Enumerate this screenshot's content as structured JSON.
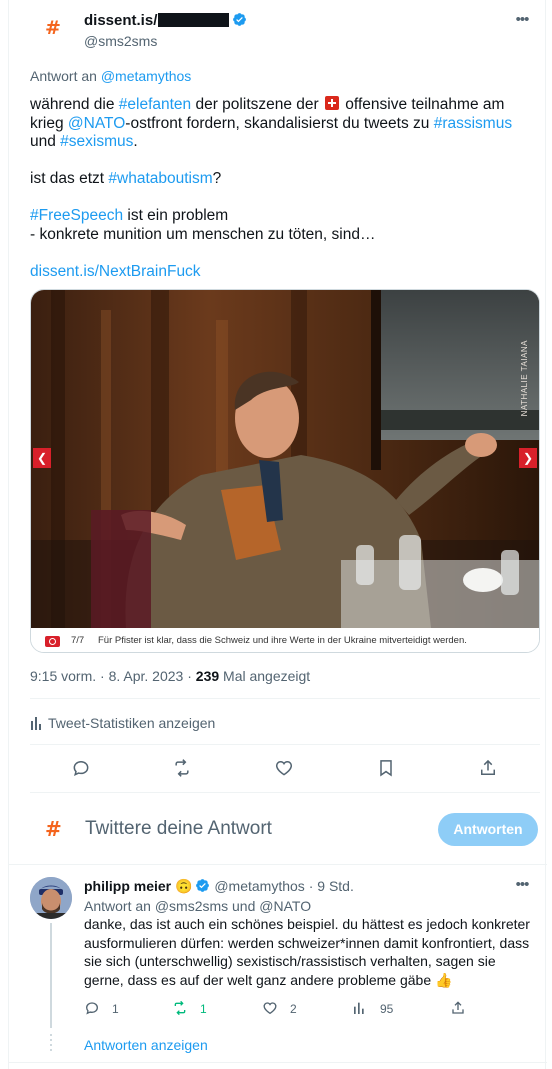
{
  "tweet": {
    "author_name": "dissent.is/",
    "author_handle": "@sms2sms",
    "reply_to_label": "Antwort an",
    "reply_to_handle": "@metamythos",
    "body": {
      "l1_a": "während die ",
      "l1_tag_elefanten": "#elefanten",
      "l1_b": " der politszene der ",
      "l1_c": " offensive teilnahme am",
      "l2_a": "krieg ",
      "l2_mention": "@NATO",
      "l2_b": "-ostfront fordern, skandalisierst du tweets zu ",
      "l2_tag": "#rassismus",
      "l3_a": "und ",
      "l3_tag": "#sexismus",
      "l3_b": ".",
      "l4_a": "ist das etzt ",
      "l4_tag": "#whataboutism",
      "l4_b": "?",
      "l5_tag": "#FreeSpeech",
      "l5_b": " ist ein problem",
      "l6": "- konkrete munition um menschen zu töten, sind…",
      "link": "dissent.is/NextBrainFuck"
    },
    "media": {
      "credit": "NATHALIE TAIANA",
      "caption_count": "7/7",
      "caption": "Für Pfister ist klar, dass die Schweiz und ihre Werte in der Ukraine mitverteidigt werden."
    },
    "time": "9:15 vorm.",
    "date": "8. Apr. 2023",
    "views_count": "239",
    "views_label": "Mal angezeigt",
    "stats_link": "Tweet-Statistiken anzeigen"
  },
  "compose": {
    "placeholder": "Twittere deine Antwort",
    "button": "Antworten"
  },
  "reply": {
    "author_name": "philipp meier",
    "author_handle": "@metamythos",
    "time": "9 Std.",
    "reply_to": "Antwort an @sms2sms und @NATO",
    "text": "danke, das ist auch ein schönes beispiel. du hättest es jedoch konkreter ausformulieren dürfen: werden schweizer*innen damit konfrontiert, dass sie sich (unterschwellig) sexistisch/rassistisch verhalten, sagen sie gerne, dass es auf der welt ganz andere probleme gäbe 👍",
    "replies": "1",
    "retweets": "1",
    "likes": "2",
    "views": "95",
    "show_replies": "Antworten anzeigen"
  },
  "colors": {
    "accent": "#1d9bf0",
    "logo": "#f4641d",
    "retweet_green": "#00ba7c",
    "swiss_red": "#da291c"
  }
}
